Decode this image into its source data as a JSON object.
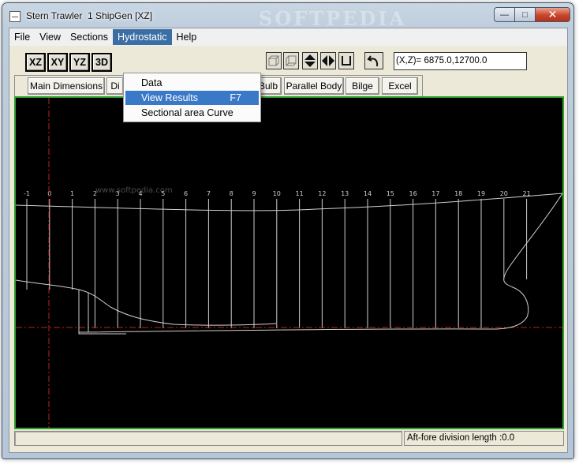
{
  "window": {
    "title": "Stern Trawler  1 ShipGen [XZ]",
    "watermark": "SOFTPEDIA",
    "watermark_small": "www.softpedia.com"
  },
  "menu": {
    "items": [
      "File",
      "View",
      "Sections",
      "Hydrostatic",
      "Help"
    ],
    "active": "Hydrostatic"
  },
  "hydrostatic_menu": {
    "items": [
      {
        "label": "Data",
        "shortcut": ""
      },
      {
        "label": "View Results",
        "shortcut": "F7"
      },
      {
        "label": "Sectional area Curve",
        "shortcut": ""
      }
    ],
    "highlighted": "View Results"
  },
  "toolbar": {
    "view_buttons": [
      "XZ",
      "XY",
      "YZ",
      "3D"
    ],
    "icon_buttons": [
      "cube-front-icon",
      "cube-back-icon",
      "vertical-flip-icon",
      "horizontal-flip-icon",
      "u-section-icon",
      "undo-icon"
    ],
    "coordinates": "(X,Z)= 6875.0,12700.0"
  },
  "toolbar2": {
    "buttons": [
      "Main Dimensions",
      "Di",
      "Bulb",
      "Parallel Body",
      "Bilge",
      "Excel"
    ]
  },
  "drawing": {
    "station_labels": [
      "-1",
      "0",
      "1",
      "2",
      "3",
      "4",
      "5",
      "6",
      "7",
      "8",
      "9",
      "10",
      "11",
      "12",
      "13",
      "14",
      "15",
      "16",
      "17",
      "18",
      "19",
      "20",
      "21"
    ],
    "colors": {
      "background": "#000000",
      "lines": "#cfcfcf",
      "reference_line": "#c02020",
      "frame": "#2fa02f"
    }
  },
  "status": {
    "left": "",
    "right": "Aft-fore division length :0.0"
  }
}
